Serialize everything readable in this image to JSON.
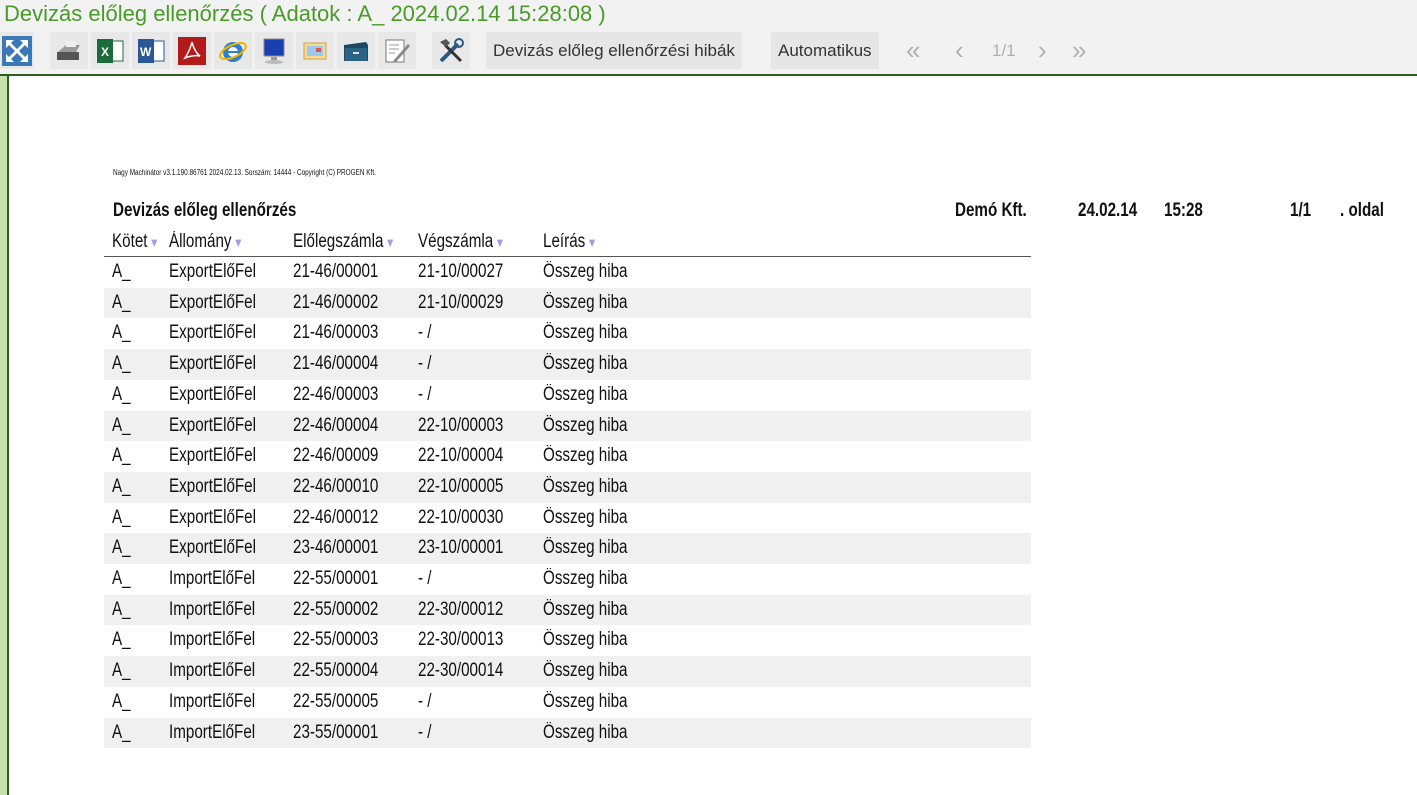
{
  "window": {
    "title": "Devizás előleg ellenőrzés ( Adatok : A_ 2024.02.14 15:28:08 )"
  },
  "toolbar": {
    "icons": [
      "expand-icon",
      "printer-icon",
      "excel-icon",
      "word-icon",
      "pdf-icon",
      "internet-explorer-icon",
      "monitor-icon",
      "email-icon",
      "archive-icon",
      "edit-icon",
      "tools-icon"
    ],
    "report_button": "Devizás előleg ellenőrzési hibák",
    "auto_button": "Automatikus",
    "first": "«",
    "prev": "‹",
    "page": "1/1",
    "next": "›",
    "last": "»"
  },
  "report": {
    "copyright": "Nagy Machinátor v3.1.190.86761 2024.02.13. Sorszám: 14444 - Copyright (C) PROGEN Kft.",
    "title": "Devizás előleg ellenőrzés",
    "company": "Demó Kft.",
    "date": "24.02.14",
    "time": "15:28",
    "page": "1/1",
    "page_suffix": ". oldal",
    "columns": [
      "Kötet",
      "Állomány",
      "Előlegszámla",
      "Végszámla",
      "Leírás"
    ],
    "rows": [
      [
        "A_",
        "ExportElőFel",
        "21-46/00001",
        "21-10/00027",
        "Összeg hiba"
      ],
      [
        "A_",
        "ExportElőFel",
        "21-46/00002",
        "21-10/00029",
        "Összeg hiba"
      ],
      [
        "A_",
        "ExportElőFel",
        "21-46/00003",
        "- /",
        "Összeg hiba"
      ],
      [
        "A_",
        "ExportElőFel",
        "21-46/00004",
        "- /",
        "Összeg hiba"
      ],
      [
        "A_",
        "ExportElőFel",
        "22-46/00003",
        "- /",
        "Összeg hiba"
      ],
      [
        "A_",
        "ExportElőFel",
        "22-46/00004",
        "22-10/00003",
        "Összeg hiba"
      ],
      [
        "A_",
        "ExportElőFel",
        "22-46/00009",
        "22-10/00004",
        "Összeg hiba"
      ],
      [
        "A_",
        "ExportElőFel",
        "22-46/00010",
        "22-10/00005",
        "Összeg hiba"
      ],
      [
        "A_",
        "ExportElőFel",
        "22-46/00012",
        "22-10/00030",
        "Összeg hiba"
      ],
      [
        "A_",
        "ExportElőFel",
        "23-46/00001",
        "23-10/00001",
        "Összeg hiba"
      ],
      [
        "A_",
        "ImportElőFel",
        "22-55/00001",
        "- /",
        "Összeg hiba"
      ],
      [
        "A_",
        "ImportElőFel",
        "22-55/00002",
        "22-30/00012",
        "Összeg hiba"
      ],
      [
        "A_",
        "ImportElőFel",
        "22-55/00003",
        "22-30/00013",
        "Összeg hiba"
      ],
      [
        "A_",
        "ImportElőFel",
        "22-55/00004",
        "22-30/00014",
        "Összeg hiba"
      ],
      [
        "A_",
        "ImportElőFel",
        "22-55/00005",
        "- /",
        "Összeg hiba"
      ],
      [
        "A_",
        "ImportElőFel",
        "23-55/00001",
        "- /",
        "Összeg hiba"
      ]
    ]
  }
}
